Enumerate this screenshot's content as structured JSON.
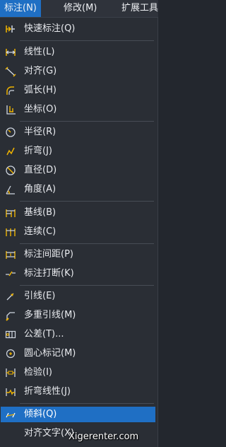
{
  "menubar": {
    "items": [
      {
        "label": "标注(N)"
      },
      {
        "label": "修改(M)"
      },
      {
        "label": "扩展工具"
      }
    ]
  },
  "menu": {
    "items": [
      {
        "label": "快速标注(Q)",
        "icon": "quick-dimension-icon"
      },
      {
        "label": "线性(L)",
        "icon": "linear-icon"
      },
      {
        "label": "对齐(G)",
        "icon": "aligned-icon"
      },
      {
        "label": "弧长(H)",
        "icon": "arc-length-icon"
      },
      {
        "label": "坐标(O)",
        "icon": "ordinate-icon"
      },
      {
        "label": "半径(R)",
        "icon": "radius-icon"
      },
      {
        "label": "折弯(J)",
        "icon": "jogged-icon"
      },
      {
        "label": "直径(D)",
        "icon": "diameter-icon"
      },
      {
        "label": "角度(A)",
        "icon": "angular-icon"
      },
      {
        "label": "基线(B)",
        "icon": "baseline-icon"
      },
      {
        "label": "连续(C)",
        "icon": "continue-icon"
      },
      {
        "label": "标注间距(P)",
        "icon": "dimension-space-icon"
      },
      {
        "label": "标注打断(K)",
        "icon": "dimension-break-icon"
      },
      {
        "label": "引线(E)",
        "icon": "leader-icon"
      },
      {
        "label": "多重引线(M)",
        "icon": "multileader-icon"
      },
      {
        "label": "公差(T)...",
        "icon": "tolerance-icon"
      },
      {
        "label": "圆心标记(M)",
        "icon": "center-mark-icon"
      },
      {
        "label": "检验(I)",
        "icon": "inspection-icon"
      },
      {
        "label": "折弯线性(J)",
        "icon": "jogged-linear-icon"
      },
      {
        "label": "倾斜(Q)",
        "icon": "oblique-icon"
      },
      {
        "label": "对齐文字(X)",
        "icon": ""
      }
    ]
  },
  "watermark": "Xigerenter.com",
  "colors": {
    "background": "#2a2e35",
    "highlight": "#1f6fc4",
    "icon_accent": "#f0b400"
  }
}
